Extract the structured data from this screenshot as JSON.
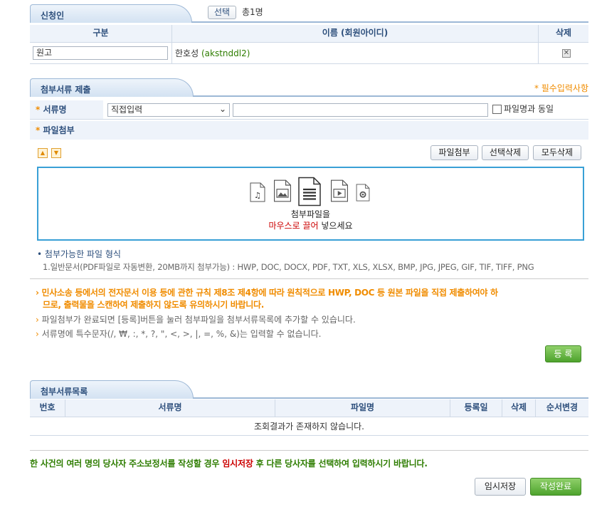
{
  "applicant": {
    "tab_title": "신청인",
    "select_button": "선택",
    "count": "총1명",
    "headers": {
      "category": "구분",
      "name": "이름 (회원아이디)",
      "delete": "삭제"
    },
    "row": {
      "category_value": "원고",
      "name": "한호성",
      "user_id": "(akstnddl2)"
    }
  },
  "documents": {
    "tab_title": "첨부서류 제출",
    "required_note": "* 필수입력사항",
    "doc_name_label": "서류명",
    "doc_type_selected": "직접입력",
    "doc_name_value": "",
    "same_as_filename_label": "파일명과 동일",
    "attach_label": "파일첨부",
    "buttons": {
      "attach": "파일첨부",
      "delete_selected": "선택삭제",
      "delete_all": "모두삭제"
    },
    "drop_line1": "첨부파일을",
    "drop_line2_red": "마우스로 끌어",
    "drop_line2_rest": "넣으세요",
    "formats_title": "첨부가능한 파일 형식",
    "formats_text": "1.일반문서(PDF파일로 자동변환, 20MB까지 첨부가능) : HWP, DOC, DOCX, PDF, TXT, XLS, XLSX, BMP, JPG, JPEG, GIF, TIF, TIFF, PNG",
    "notice1_line1": "민사소송 등에서의 전자문서 이용 등에 관한 규칙 제8조 제4항에 따라 원칙적으로 HWP, DOC 등 원본 파일을 직접 제출하여야 하",
    "notice1_line2": "므로, 출력물을 스캔하여 제출하지 않도록 유의하시기 바랍니다.",
    "notice2": "파일첨부가 완료되면 [등록]버튼을 눌러 첨부파일을 첨부서류목록에 추가할 수 있습니다.",
    "notice3": "서류명에 특수문자(/, ₩, :, *, ?, \", <, >, |, =, %, &)는 입력할 수 없습니다.",
    "register_button": "등 록"
  },
  "doc_list": {
    "tab_title": "첨부서류목록",
    "headers": [
      "번호",
      "서류명",
      "파일명",
      "등록일",
      "삭제",
      "순서변경"
    ],
    "empty_message": "조회결과가 존재하지 않습니다."
  },
  "footer": {
    "notice_part1": "한 사건의 여러 명의 당사자 주소보정서를 작성할 경우",
    "notice_red": "임시저장",
    "notice_part2": "후 다른 당사자를 선택하여 입력하시기 바랍니다.",
    "temp_save_button": "임시저장",
    "complete_button": "작성완료"
  },
  "colors": {
    "accent_orange": "#f08c00",
    "header_blue": "#2d4f7c",
    "green_text": "#2e7d00",
    "red_text": "#cc0000"
  }
}
